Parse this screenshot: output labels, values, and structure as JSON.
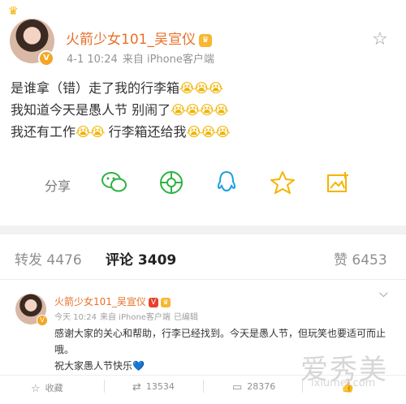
{
  "post": {
    "author_name": "火箭少女101_吴宣仪",
    "author_badge_icon": "fan-badge-icon",
    "timestamp": "4-1 10:24",
    "source": "来自 iPhone客户端",
    "text_lines": [
      {
        "text": "是谁拿（错）走了我的行李箱",
        "emoji": "😭😭😭"
      },
      {
        "text": "我知道今天是愚人节 别闹了",
        "emoji": "😭😭😭😭"
      },
      {
        "text": "我还有工作",
        "emoji": "😭😭",
        "text2": " 行李箱还给我",
        "emoji2": "😭😭😭"
      }
    ],
    "share_label": "分享",
    "share_icons": [
      "wechat-icon",
      "moments-icon",
      "qq-icon",
      "qzone-star-icon",
      "save-image-icon"
    ],
    "favorite_icon": "star-outline-icon"
  },
  "tabs": [
    {
      "label": "转发 4476",
      "active": false
    },
    {
      "label": "评论 3409",
      "active": true
    },
    {
      "label": "赞 6453",
      "active": false
    }
  ],
  "comment": {
    "author_name": "火箭少女101_吴宣仪",
    "verified_badge": "V",
    "timestamp": "今天 10:24",
    "source": "来自 iPhone客户端",
    "edited": "已编辑",
    "text_p1": "感谢大家的关心和帮助，行李已经找到。今天是愚人节，但玩笑也要适可而止哦。",
    "text_p2": "祝大家愚人节快乐",
    "heart": "💙",
    "actions": [
      {
        "icon": "bookmark-icon",
        "label": "收藏"
      },
      {
        "icon": "repost-icon",
        "label": "13534"
      },
      {
        "icon": "comment-icon",
        "label": "28376"
      },
      {
        "icon": "like-icon",
        "label": ""
      }
    ]
  },
  "watermark": {
    "text": "爱秀美",
    "url": "ixiumei.com"
  }
}
